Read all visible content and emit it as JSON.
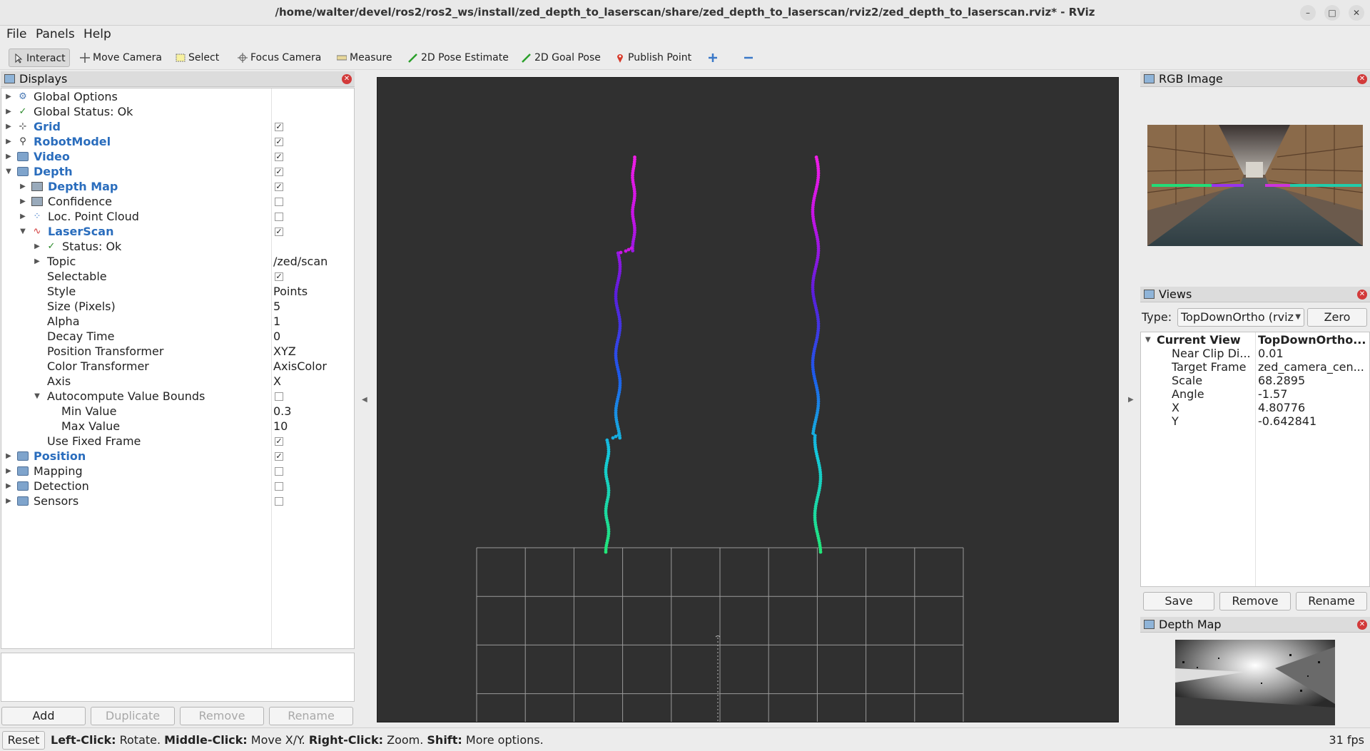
{
  "window": {
    "title": "/home/walter/devel/ros2/ros2_ws/install/zed_depth_to_laserscan/share/zed_depth_to_laserscan/rviz2/zed_depth_to_laserscan.rviz* - RViz"
  },
  "menu": {
    "file": "File",
    "panels": "Panels",
    "help": "Help"
  },
  "toolbar": {
    "interact": "Interact",
    "move_camera": "Move Camera",
    "select": "Select",
    "focus_camera": "Focus Camera",
    "measure": "Measure",
    "pose_estimate": "2D Pose Estimate",
    "goal_pose": "2D Goal Pose",
    "publish_point": "Publish Point"
  },
  "displays": {
    "title": "Displays",
    "rows": [
      {
        "label": "Global Options"
      },
      {
        "label": "Global Status: Ok"
      },
      {
        "label": "Grid"
      },
      {
        "label": "RobotModel"
      },
      {
        "label": "Video"
      },
      {
        "label": "Depth"
      },
      {
        "label": "Depth Map"
      },
      {
        "label": "Confidence"
      },
      {
        "label": "Loc. Point Cloud"
      },
      {
        "label": "LaserScan"
      },
      {
        "label": "Status: Ok"
      },
      {
        "label": "Topic",
        "value": "/zed/scan"
      },
      {
        "label": "Selectable"
      },
      {
        "label": "Style",
        "value": "Points"
      },
      {
        "label": "Size (Pixels)",
        "value": "5"
      },
      {
        "label": "Alpha",
        "value": "1"
      },
      {
        "label": "Decay Time",
        "value": "0"
      },
      {
        "label": "Position Transformer",
        "value": "XYZ"
      },
      {
        "label": "Color Transformer",
        "value": "AxisColor"
      },
      {
        "label": "Axis",
        "value": "X"
      },
      {
        "label": "Autocompute Value Bounds"
      },
      {
        "label": "Min Value",
        "value": "0.3"
      },
      {
        "label": "Max Value",
        "value": "10"
      },
      {
        "label": "Use Fixed Frame"
      },
      {
        "label": "Position"
      },
      {
        "label": "Mapping"
      },
      {
        "label": "Detection"
      },
      {
        "label": "Sensors"
      }
    ],
    "buttons": {
      "add": "Add",
      "duplicate": "Duplicate",
      "remove": "Remove",
      "rename": "Rename"
    }
  },
  "rgb_panel": {
    "title": "RGB Image"
  },
  "views": {
    "title": "Views",
    "type_label": "Type:",
    "type_value": "TopDownOrtho (rviz",
    "zero": "Zero",
    "current_view": "Current View",
    "current_view_value": "TopDownOrtho...",
    "props": [
      {
        "key": "Near Clip Di...",
        "value": "0.01"
      },
      {
        "key": "Target Frame",
        "value": "zed_camera_cen..."
      },
      {
        "key": "Scale",
        "value": "68.2895"
      },
      {
        "key": "Angle",
        "value": "-1.57"
      },
      {
        "key": "X",
        "value": "4.80776"
      },
      {
        "key": "Y",
        "value": "-0.642841"
      }
    ],
    "buttons": {
      "save": "Save",
      "remove": "Remove",
      "rename": "Rename"
    }
  },
  "depth_panel": {
    "title": "Depth Map"
  },
  "statusbar": {
    "reset": "Reset",
    "left_click": "Left-Click:",
    "left_click_desc": " Rotate. ",
    "middle_click": "Middle-Click:",
    "middle_click_desc": " Move X/Y. ",
    "right_click": "Right-Click:",
    "right_click_desc": " Zoom. ",
    "shift": "Shift:",
    "shift_desc": " More options.",
    "fps": "31 fps"
  }
}
